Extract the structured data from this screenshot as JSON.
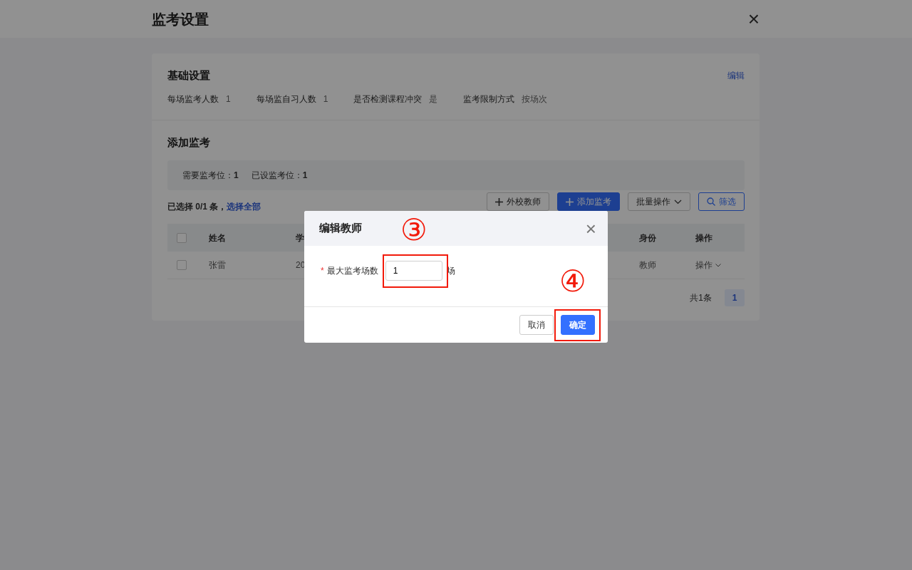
{
  "header": {
    "title": "监考设置",
    "close": "×"
  },
  "basic_settings": {
    "title": "基础设置",
    "edit_link": "编辑",
    "items": [
      {
        "label": "每场监考人数",
        "value": "1"
      },
      {
        "label": "每场监自习人数",
        "value": "1"
      },
      {
        "label": "是否检测课程冲突",
        "value": "是"
      },
      {
        "label": "监考限制方式",
        "value": "按场次"
      }
    ]
  },
  "add_section": {
    "title": "添加监考",
    "stats": [
      {
        "label": "需要监考位：",
        "value": "1"
      },
      {
        "label": "已设监考位：",
        "value": "1"
      }
    ],
    "selection_text": "已选择 0/1 条，",
    "select_all_link": "选择全部",
    "toolbar": [
      {
        "label": "外校教师",
        "kind": "add"
      },
      {
        "label": "添加监考",
        "kind": "primary"
      },
      {
        "label": "批量操作",
        "kind": "dropdown"
      },
      {
        "label": "筛选",
        "kind": "filter"
      }
    ]
  },
  "table": {
    "select_all_checked": false,
    "columns": [
      "姓名",
      "学",
      "身份",
      "操作"
    ],
    "rows": [
      {
        "checked": false,
        "cells": [
          "张雷",
          "20",
          "教师",
          "操作"
        ]
      }
    ]
  },
  "pagination": {
    "total": "共1条",
    "pages": [
      {
        "label": "1",
        "selected": true
      }
    ]
  },
  "modal": {
    "title": "编辑教师",
    "close": "×",
    "field": {
      "required_mark": "*",
      "label": "最大监考场数",
      "value": "1",
      "unit": "场"
    },
    "buttons": [
      {
        "label": "取消",
        "kind": "secondary"
      },
      {
        "label": "确定",
        "kind": "primary"
      }
    ]
  },
  "annotations": [
    {
      "label": "③"
    },
    {
      "label": "④"
    }
  ]
}
